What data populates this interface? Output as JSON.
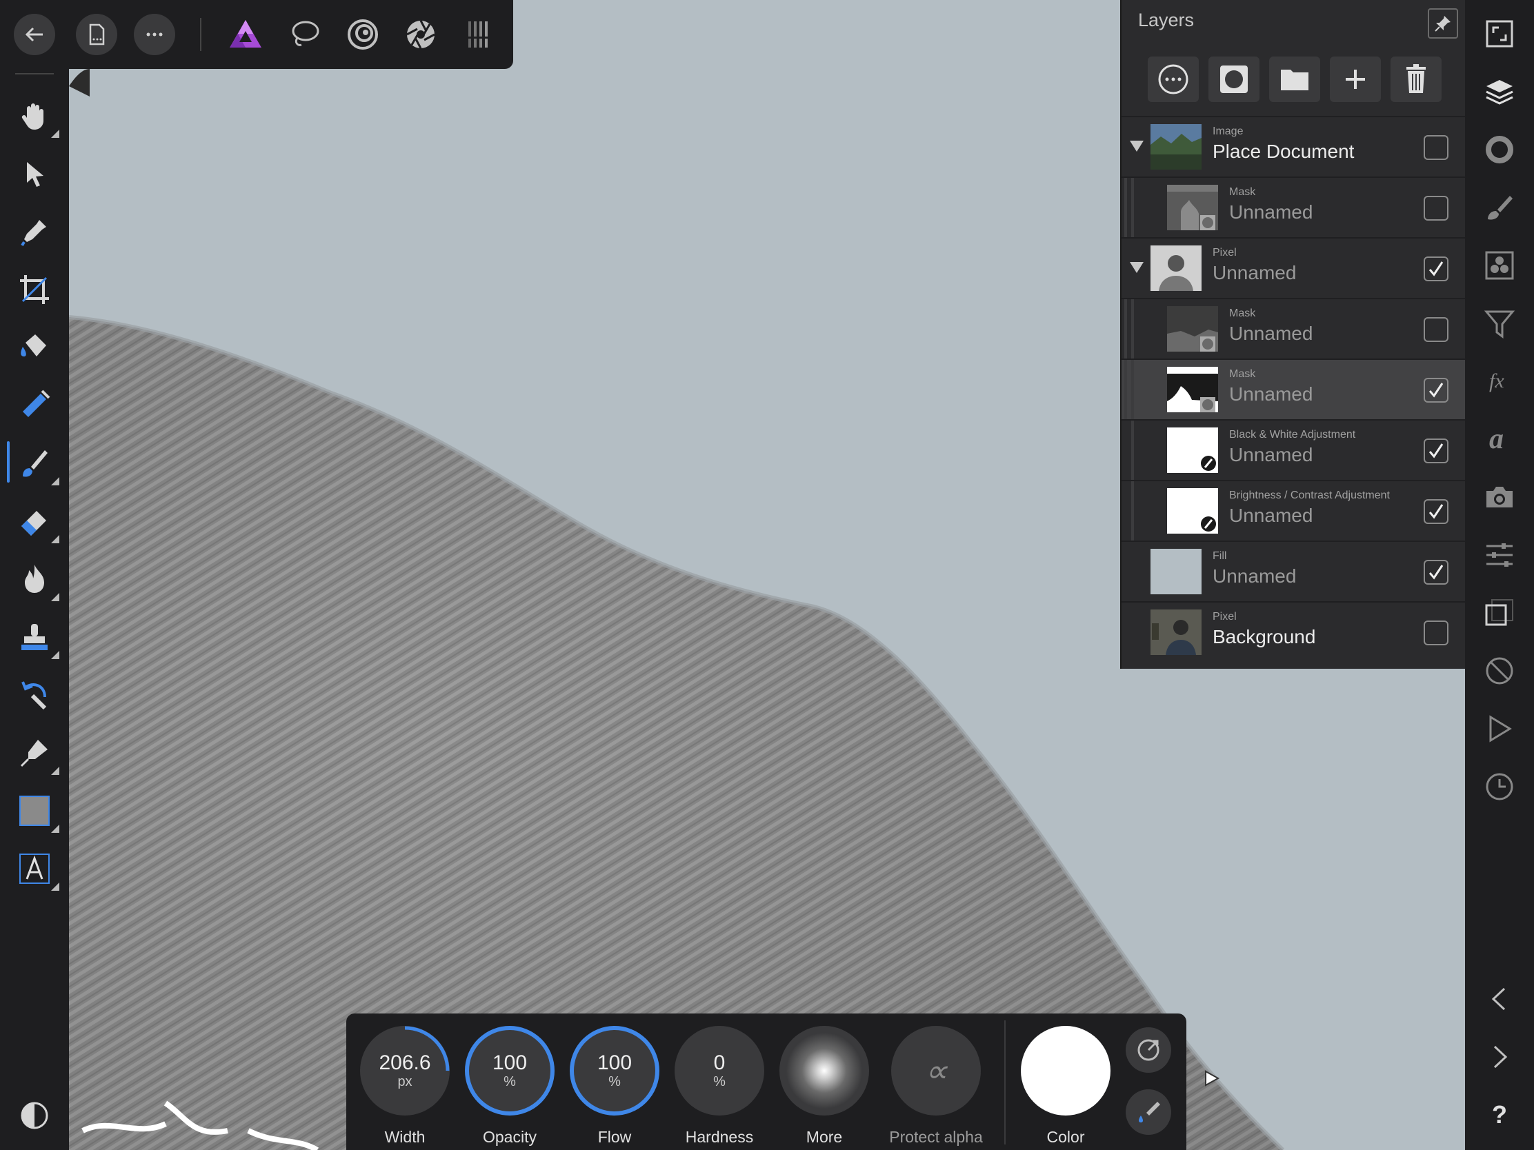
{
  "top_toolbar": {
    "buttons": [
      "back-icon",
      "document-icon",
      "more-icon"
    ],
    "personas": [
      "photo-persona-icon",
      "selection-persona-icon",
      "liquify-persona-icon",
      "develop-persona-icon",
      "tone-mapping-persona-icon"
    ]
  },
  "left_tools": [
    "hand-tool",
    "move-tool",
    "color-picker-tool",
    "crop-tool",
    "flood-fill-tool",
    "gradient-tool",
    "paint-brush-tool",
    "erase-brush-tool",
    "burn-brush-tool",
    "clone-brush-tool",
    "undo-brush-tool",
    "pen-tool",
    "rectangle-tool",
    "artistic-text-tool"
  ],
  "active_tool": "paint-brush-tool",
  "layers": {
    "title": "Layers",
    "rows": [
      {
        "type": "Image",
        "name": "Place Document",
        "checked": false,
        "expanded": true
      },
      {
        "type": "Mask",
        "name": "Unnamed",
        "checked": false
      },
      {
        "type": "Pixel",
        "name": "Unnamed",
        "checked": true,
        "expanded": true
      },
      {
        "type": "Mask",
        "name": "Unnamed",
        "checked": false
      },
      {
        "type": "Mask",
        "name": "Unnamed",
        "checked": true,
        "selected": true
      },
      {
        "type": "Black & White Adjustment",
        "name": "Unnamed",
        "checked": true
      },
      {
        "type": "Brightness / Contrast Adjustment",
        "name": "Unnamed",
        "checked": true
      },
      {
        "type": "Fill",
        "name": "Unnamed",
        "checked": true
      },
      {
        "type": "Pixel",
        "name": "Background",
        "checked": false
      }
    ]
  },
  "context_toolbar": {
    "width": {
      "value": "206.6",
      "unit": "px",
      "label": "Width"
    },
    "opacity": {
      "value": "100",
      "unit": "%",
      "label": "Opacity",
      "level": 1.0
    },
    "flow": {
      "value": "100",
      "unit": "%",
      "label": "Flow",
      "level": 1.0
    },
    "hardness": {
      "value": "0",
      "unit": "%",
      "label": "Hardness"
    },
    "more": {
      "label": "More"
    },
    "protect_alpha": {
      "symbol": "∝",
      "label": "Protect alpha"
    },
    "color": {
      "label": "Color",
      "value": "#ffffff"
    }
  },
  "right_studio": [
    "navigator-icon",
    "layers-icon",
    "color-icon",
    "brushes-icon",
    "channels-icon",
    "adjustments-icon",
    "fx-icon",
    "text-styles-icon",
    "snapshots-icon",
    "transform-icon",
    "stock-icon",
    "history-icon"
  ],
  "help_symbol": "?",
  "accent_color": "#3f87e8"
}
